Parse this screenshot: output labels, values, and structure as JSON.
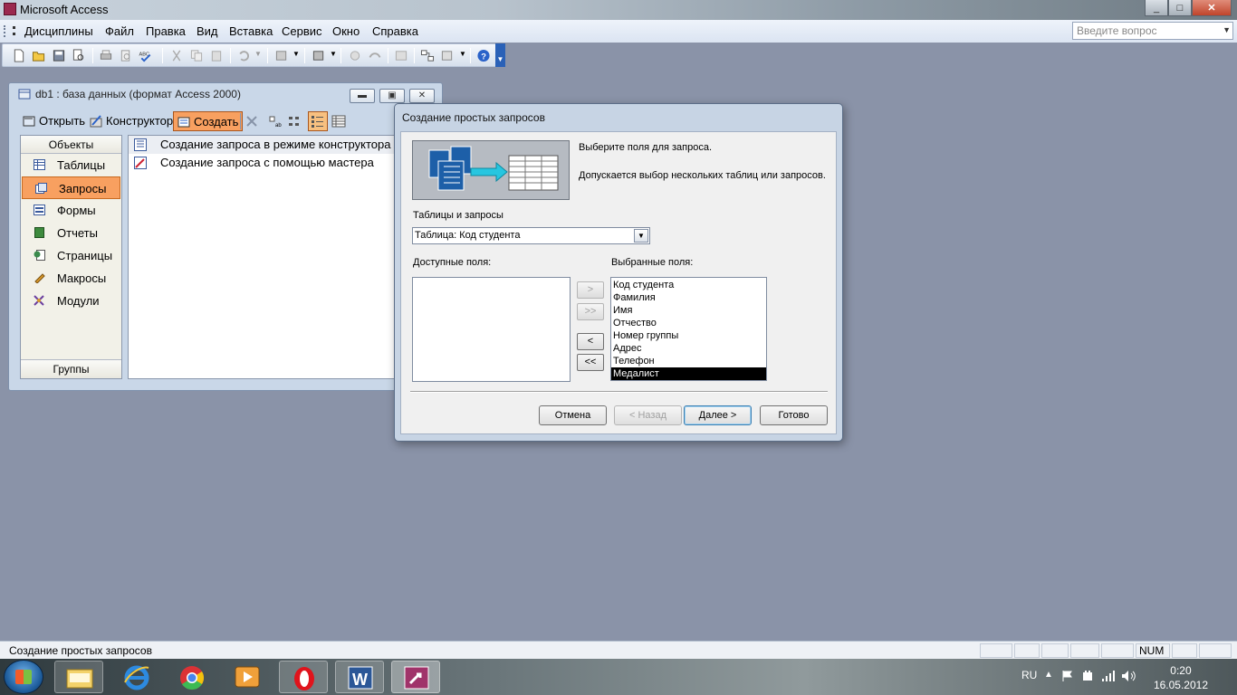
{
  "app": {
    "title": "Microsoft Access",
    "window_buttons": {
      "minimize": "_",
      "maximize": "□",
      "close": "✕"
    }
  },
  "menu": {
    "items": [
      "Дисциплины",
      "Файл",
      "Правка",
      "Вид",
      "Вставка",
      "Сервис",
      "Окно",
      "Справка"
    ],
    "question_placeholder": "Введите вопрос"
  },
  "dbwindow": {
    "title": "db1 : база данных (формат Access 2000)",
    "toolbar": {
      "open": "Открыть",
      "design": "Конструктор",
      "create": "Создать"
    },
    "objects_header": "Объекты",
    "objects": [
      "Таблицы",
      "Запросы",
      "Формы",
      "Отчеты",
      "Страницы",
      "Макросы",
      "Модули"
    ],
    "selected_object": "Запросы",
    "groups": "Группы",
    "list": [
      "Создание запроса в режиме конструктора",
      "Создание запроса с помощью мастера"
    ]
  },
  "wizard": {
    "title": "Создание простых запросов",
    "desc1": "Выберите поля для запроса.",
    "desc2": "Допускается выбор нескольких таблиц или запросов.",
    "tables_label": "Таблицы и запросы",
    "tables_value": "Таблица: Код студента",
    "available_label": "Доступные поля:",
    "selected_label": "Выбранные поля:",
    "available_fields": [],
    "selected_fields": [
      "Код студента",
      "Фамилия",
      "Имя",
      "Отчество",
      "Номер группы",
      "Адрес",
      "Телефон",
      "Медалист"
    ],
    "selected_highlight": "Медалист",
    "move_buttons": {
      "add": ">",
      "add_all": ">>",
      "remove": "<",
      "remove_all": "<<"
    },
    "buttons": {
      "cancel": "Отмена",
      "back": "< Назад",
      "next": "Далее >",
      "finish": "Готово"
    }
  },
  "statusbar": {
    "text": "Создание простых запросов",
    "num": "NUM"
  },
  "taskbar": {
    "language": "RU",
    "time": "0:20",
    "date": "16.05.2012"
  }
}
